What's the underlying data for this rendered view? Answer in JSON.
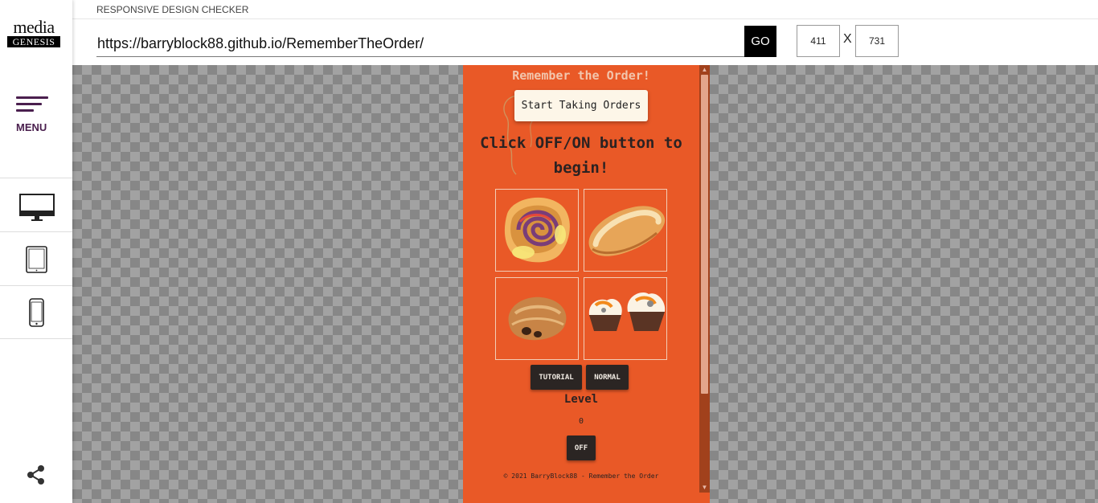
{
  "app": {
    "title": "RESPONSIVE DESIGN CHECKER",
    "logo_top": "media",
    "logo_bottom": "GENESIS"
  },
  "sidebar": {
    "menu_label": "MENU",
    "devices": [
      "desktop-icon",
      "tablet-icon",
      "phone-icon"
    ],
    "share": "share-icon"
  },
  "toolbar": {
    "url": "https://barryblock88.github.io/RememberTheOrder/",
    "go_label": "GO",
    "width": "411",
    "separator": "X",
    "height": "731"
  },
  "site": {
    "title": "Remember the Order!",
    "start_button": "Start Taking Orders",
    "instruction": "Click OFF/ON button to begin!",
    "tiles": [
      "cinnamon-roll",
      "bread-roll",
      "pain-au-chocolat",
      "cupcakes"
    ],
    "tutorial_button": "TUTORIAL",
    "normal_button": "NORMAL",
    "level_label": "Level",
    "level_value": "0",
    "power_button": "OFF",
    "footer": "© 2021 BarryBlock88 - Remember the Order"
  },
  "colors": {
    "accent": "#4a1f4e",
    "page_bg": "#e95927",
    "button_dark": "#2b2523"
  }
}
